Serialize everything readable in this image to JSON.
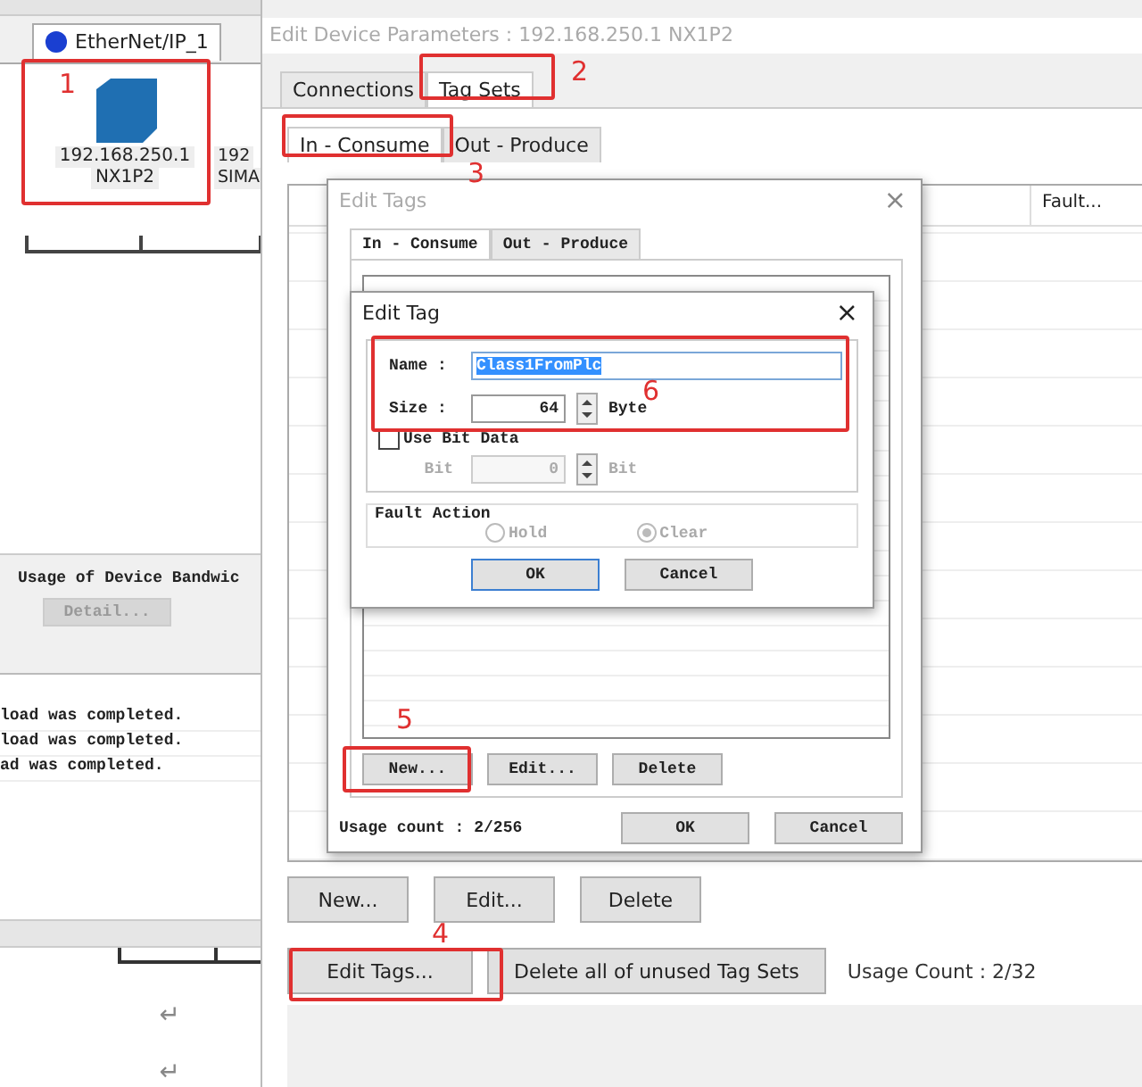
{
  "left_panel": {
    "network_tab": "EtherNet/IP_1",
    "devices": [
      {
        "ip": "192.168.250.1",
        "model": "NX1P2"
      },
      {
        "ip": "192",
        "model": "SIMA"
      }
    ],
    "bandwidth_label": "Usage of Device Bandwic",
    "detail_button": {
      "label": "Detail...",
      "disabled": true
    },
    "log_lines": [
      "load was completed.",
      "load was completed.",
      "ad was completed."
    ],
    "paragraph_marks": [
      "↵",
      "↵"
    ]
  },
  "main_dialog": {
    "title": "Edit Device Parameters : 192.168.250.1 NX1P2",
    "tabs": [
      {
        "label": "Connections",
        "selected": false
      },
      {
        "label": "Tag Sets",
        "selected": true
      }
    ],
    "subtabs": [
      {
        "label": "In - Consume",
        "selected": true
      },
      {
        "label": "Out - Produce",
        "selected": false
      }
    ],
    "table": {
      "columns": [
        "Fault..."
      ]
    },
    "buttons": [
      "New...",
      "Edit...",
      "Delete"
    ],
    "edit_tags_button": "Edit Tags...",
    "delete_unused_button": "Delete all of unused Tag Sets",
    "usage_count": "Usage Count : 2/32"
  },
  "edit_tags_dialog": {
    "title": "Edit Tags",
    "close": "×",
    "tabs": [
      {
        "label": "In - Consume",
        "selected": true
      },
      {
        "label": "Out - Produce",
        "selected": false
      }
    ],
    "buttons": [
      "New...",
      "Edit...",
      "Delete"
    ],
    "usage_count": "Usage count : 2/256",
    "ok": "OK",
    "cancel": "Cancel"
  },
  "edit_tag_dialog": {
    "title": "Edit Tag",
    "close": "×",
    "name_label": "Name :",
    "name_value": "Class1FromPlc",
    "size_label": "Size :",
    "size_value": "64",
    "size_unit": "Byte",
    "use_bit_data": {
      "label": "Use Bit Data",
      "checked": false
    },
    "bit": {
      "label": "Bit",
      "value": "0",
      "unit": "Bit",
      "disabled": true
    },
    "fault_action": {
      "title": "Fault Action",
      "disabled": true,
      "options": [
        {
          "label": "Hold",
          "selected": false
        },
        {
          "label": "Clear",
          "selected": true
        }
      ]
    },
    "ok": "OK",
    "cancel": "Cancel"
  },
  "annotations": [
    "1",
    "2",
    "3",
    "4",
    "5",
    "6"
  ]
}
